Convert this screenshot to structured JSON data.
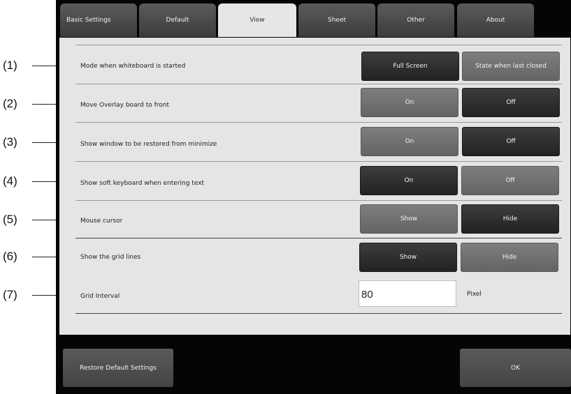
{
  "callouts": [
    "(1)",
    "(2)",
    "(3)",
    "(4)",
    "(5)",
    "(6)",
    "(7)"
  ],
  "tabs": [
    {
      "label": "Basic Settings",
      "active": false
    },
    {
      "label": "Default",
      "active": false
    },
    {
      "label": "View",
      "active": true
    },
    {
      "label": "Sheet",
      "active": false
    },
    {
      "label": "Other",
      "active": false
    },
    {
      "label": "About",
      "active": false
    }
  ],
  "rows": [
    {
      "label": "Mode when whiteboard is started",
      "options": [
        "Full Screen",
        "State when last closed"
      ],
      "selected": 0
    },
    {
      "label": "Move Overlay board to front",
      "options": [
        "On",
        "Off"
      ],
      "selected": 1
    },
    {
      "label": "Show window to be restored from minimize",
      "options": [
        "On",
        "Off"
      ],
      "selected": 1
    },
    {
      "label": "Show soft keyboard when entering text",
      "options": [
        "On",
        "Off"
      ],
      "selected": 0
    },
    {
      "label": "Mouse cursor",
      "options": [
        "Show",
        "Hide"
      ],
      "selected": 1
    },
    {
      "label": "Show the grid lines",
      "options": [
        "Show",
        "Hide"
      ],
      "selected": 0
    }
  ],
  "grid_interval": {
    "label": "Grid Interval",
    "value": "80",
    "unit": "Pixel"
  },
  "footer": {
    "restore_label": "Restore Default Settings",
    "ok_label": "OK"
  },
  "colors": {
    "selected_button": "#2e2e2e",
    "unselected_button": "#707070",
    "panel": "#e5e5e5",
    "window": "#050505"
  }
}
